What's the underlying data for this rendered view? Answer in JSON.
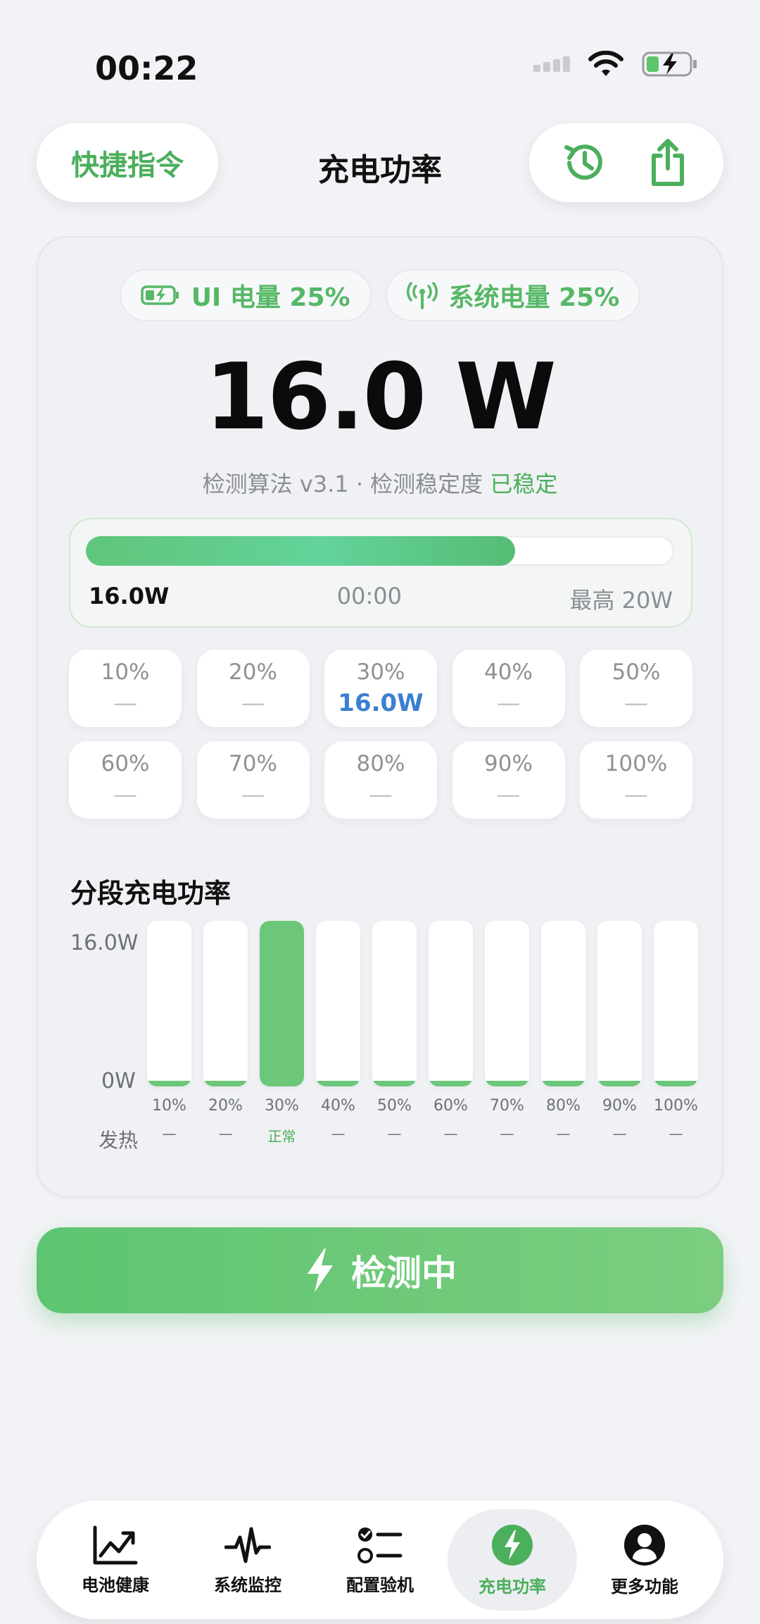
{
  "status_bar": {
    "time": "00:22"
  },
  "header": {
    "shortcut_label": "快捷指令",
    "title": "充电功率"
  },
  "badges": {
    "ui_battery": "UI 电量 25%",
    "system_battery": "系统电量 25%"
  },
  "power": {
    "value": "16.0 W",
    "algo_prefix": "检测算法 v3.1 · 检测稳定度 ",
    "stability": "已稳定"
  },
  "progress": {
    "current_label": "16.0W",
    "elapsed": "00:00",
    "max_label": "最高 20W",
    "fraction": 0.73
  },
  "levels": [
    {
      "pct": "10%",
      "value": "—"
    },
    {
      "pct": "20%",
      "value": "—"
    },
    {
      "pct": "30%",
      "value": "16.0W",
      "active": true
    },
    {
      "pct": "40%",
      "value": "—"
    },
    {
      "pct": "50%",
      "value": "—"
    },
    {
      "pct": "60%",
      "value": "—"
    },
    {
      "pct": "70%",
      "value": "—"
    },
    {
      "pct": "80%",
      "value": "—"
    },
    {
      "pct": "90%",
      "value": "—"
    },
    {
      "pct": "100%",
      "value": "—"
    }
  ],
  "segment_chart": {
    "title": "分段充电功率",
    "y_top": "16.0W",
    "y_bottom": "0W",
    "heat_label": "发热"
  },
  "chart_data": {
    "type": "bar",
    "categories": [
      "10%",
      "20%",
      "30%",
      "40%",
      "50%",
      "60%",
      "70%",
      "80%",
      "90%",
      "100%"
    ],
    "values": [
      0,
      0,
      16.0,
      0,
      0,
      0,
      0,
      0,
      0,
      0
    ],
    "status": [
      "—",
      "—",
      "正常",
      "—",
      "—",
      "—",
      "—",
      "—",
      "—",
      "—"
    ],
    "ylim": [
      0,
      16.0
    ],
    "colors": {
      "bar": "#6cc77a",
      "track": "#ffffff"
    }
  },
  "detect_button": {
    "label": "检测中"
  },
  "tabs": [
    {
      "label": "电池健康",
      "icon": "chart-up-icon"
    },
    {
      "label": "系统监控",
      "icon": "pulse-icon"
    },
    {
      "label": "配置验机",
      "icon": "checklist-icon"
    },
    {
      "label": "充电功率",
      "icon": "bolt-circle-icon",
      "active": true
    },
    {
      "label": "更多功能",
      "icon": "person-circle-icon"
    }
  ],
  "colors": {
    "accent": "#4caf5c",
    "highlight_value": "#3a7fd0"
  }
}
